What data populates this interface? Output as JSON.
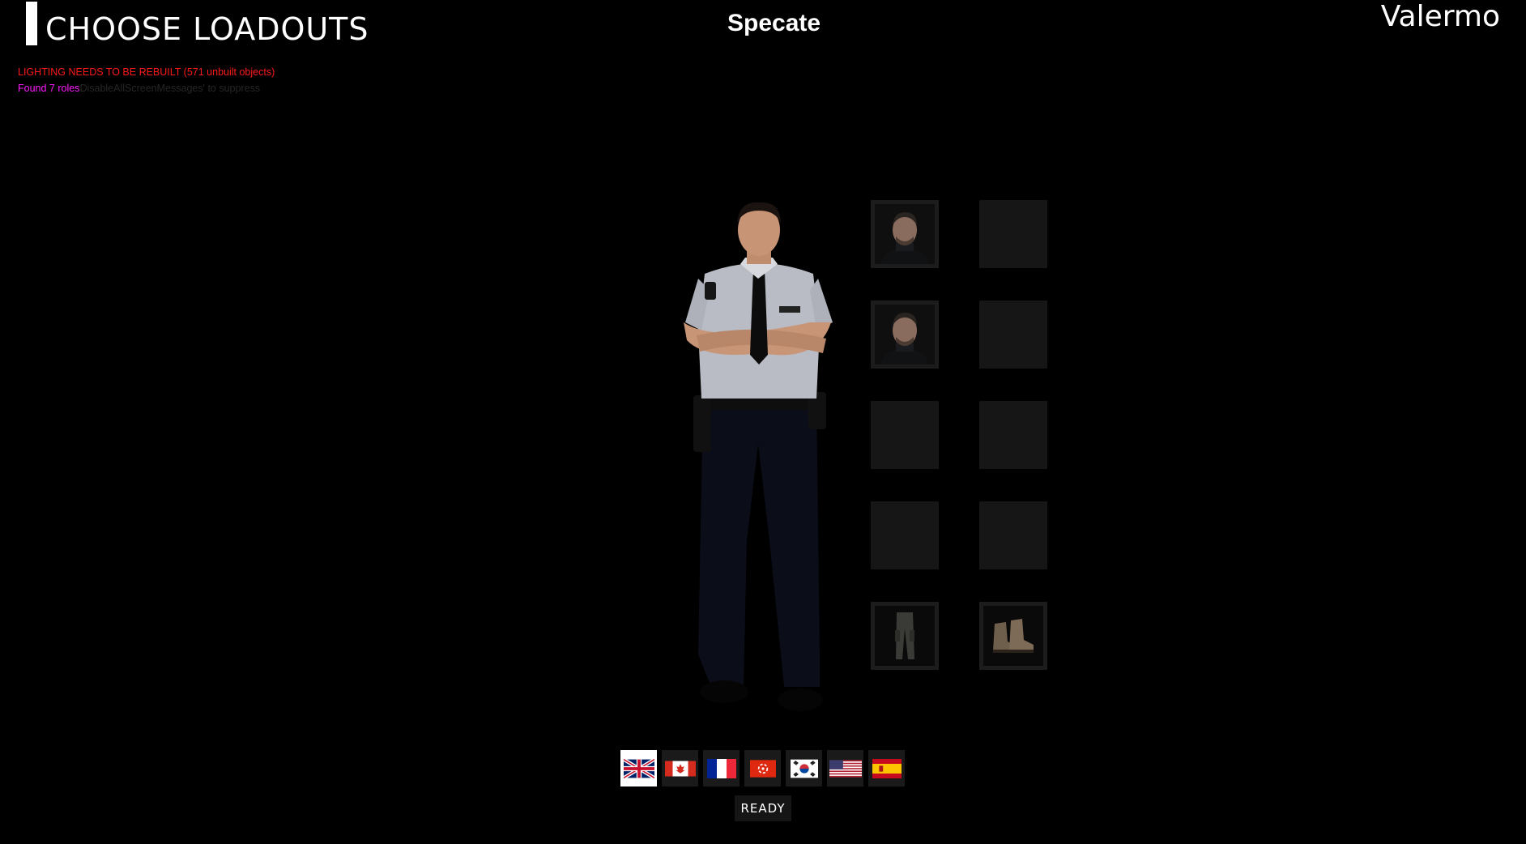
{
  "header": {
    "title": "CHOOSE LOADOUTS",
    "center_name": "Specate",
    "player_name": "Valermo"
  },
  "debug": {
    "line1": "LIGHTING NEEDS TO BE REBUILT (571 unbuilt objects)",
    "line2_highlight": "Found 7 roles",
    "line2_faded": "DisableAllScreenMessages' to suppress"
  },
  "loadout_slots": [
    {
      "row": 1,
      "col": 1,
      "item": "head-portrait",
      "filled": true
    },
    {
      "row": 1,
      "col": 2,
      "item": "",
      "filled": false
    },
    {
      "row": 2,
      "col": 1,
      "item": "head-portrait",
      "filled": true
    },
    {
      "row": 2,
      "col": 2,
      "item": "",
      "filled": false
    },
    {
      "row": 3,
      "col": 1,
      "item": "",
      "filled": false
    },
    {
      "row": 3,
      "col": 2,
      "item": "",
      "filled": false
    },
    {
      "row": 4,
      "col": 1,
      "item": "",
      "filled": false
    },
    {
      "row": 4,
      "col": 2,
      "item": "",
      "filled": false
    },
    {
      "row": 5,
      "col": 1,
      "item": "pants",
      "filled": true
    },
    {
      "row": 5,
      "col": 2,
      "item": "boots",
      "filled": true
    }
  ],
  "factions": [
    {
      "icon": "uk-flag-icon",
      "selected": true
    },
    {
      "icon": "canada-flag-icon",
      "selected": false
    },
    {
      "icon": "france-flag-icon",
      "selected": false
    },
    {
      "icon": "hong-kong-flag-icon",
      "selected": false
    },
    {
      "icon": "south-korea-flag-icon",
      "selected": false
    },
    {
      "icon": "usa-flag-icon",
      "selected": false
    },
    {
      "icon": "spain-flag-icon",
      "selected": false
    }
  ],
  "ready_label": "READY",
  "colors": {
    "background": "#000000",
    "debug_red": "#ff1a1a",
    "debug_magenta": "#ff1aff",
    "slot": "#161616"
  }
}
